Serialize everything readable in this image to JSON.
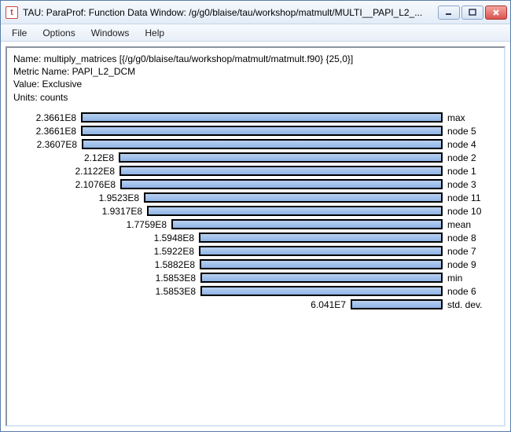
{
  "window": {
    "title": "TAU: ParaProf: Function Data Window: /g/g0/blaise/tau/workshop/matmult/MULTI__PAPI_L2_...",
    "appicon_text": "t"
  },
  "menu": {
    "items": [
      "File",
      "Options",
      "Windows",
      "Help"
    ]
  },
  "info": {
    "name_label": "Name: multiply_matrices [{/g/g0/blaise/tau/workshop/matmult/matmult.f90} {25,0}]",
    "metric_label": "Metric Name: PAPI_L2_DCM",
    "value_label": "Value: Exclusive",
    "units_label": "Units: counts"
  },
  "chart_data": {
    "type": "bar",
    "orientation": "horizontal",
    "max_value": 236610000.0,
    "rows": [
      {
        "value_label": "2.3661E8",
        "value": 236610000,
        "right_label": "max"
      },
      {
        "value_label": "2.3661E8",
        "value": 236610000,
        "right_label": "node 5"
      },
      {
        "value_label": "2.3607E8",
        "value": 236070000,
        "right_label": "node 4"
      },
      {
        "value_label": "2.12E8",
        "value": 212000000,
        "right_label": "node 2"
      },
      {
        "value_label": "2.1122E8",
        "value": 211220000,
        "right_label": "node 1"
      },
      {
        "value_label": "2.1076E8",
        "value": 210760000,
        "right_label": "node 3"
      },
      {
        "value_label": "1.9523E8",
        "value": 195230000,
        "right_label": "node 11"
      },
      {
        "value_label": "1.9317E8",
        "value": 193170000,
        "right_label": "node 10"
      },
      {
        "value_label": "1.7759E8",
        "value": 177590000,
        "right_label": "mean"
      },
      {
        "value_label": "1.5948E8",
        "value": 159480000,
        "right_label": "node 8"
      },
      {
        "value_label": "1.5922E8",
        "value": 159220000,
        "right_label": "node 7"
      },
      {
        "value_label": "1.5882E8",
        "value": 158820000,
        "right_label": "node 9"
      },
      {
        "value_label": "1.5853E8",
        "value": 158530000,
        "right_label": "min"
      },
      {
        "value_label": "1.5853E8",
        "value": 158530000,
        "right_label": "node 6"
      }
    ],
    "std_dev": {
      "value_label": "6.041E7",
      "value": 60410000,
      "right_label": "std. dev."
    }
  },
  "colors": {
    "bar_fill_top": "#b9d0f0",
    "bar_fill_bottom": "#8fb4e6",
    "bar_border": "#000000"
  }
}
